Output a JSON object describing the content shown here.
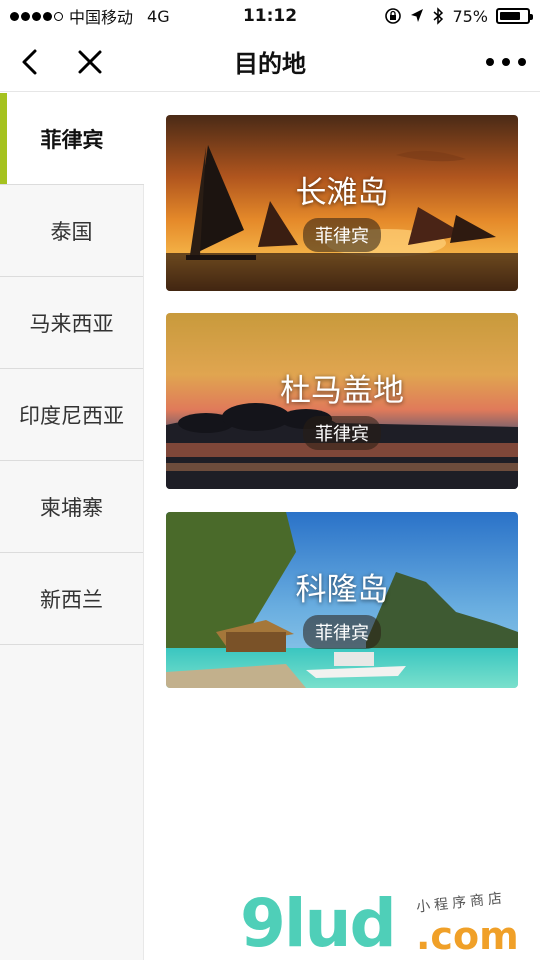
{
  "status": {
    "carrier": "中国移动",
    "network": "4G",
    "time": "11:12",
    "battery": "75%",
    "battery_level": 0.75
  },
  "nav": {
    "title": "目的地",
    "back_icon": "back-chevron-icon",
    "close_icon": "close-icon",
    "more_icon": "more-icon"
  },
  "sidebar": {
    "items": [
      {
        "label": "菲律宾"
      },
      {
        "label": "泰国"
      },
      {
        "label": "马来西亚"
      },
      {
        "label": "印度尼西亚"
      },
      {
        "label": "柬埔寨"
      },
      {
        "label": "新西兰"
      }
    ],
    "accent": "#a5c21f"
  },
  "destinations": [
    {
      "name": "长滩岛",
      "country": "菲律宾"
    },
    {
      "name": "杜马盖地",
      "country": "菲律宾"
    },
    {
      "name": "科隆岛",
      "country": "菲律宾"
    }
  ],
  "watermark": {
    "logo": "9lud",
    "domain": ".com",
    "tagline": "小程序商店"
  }
}
